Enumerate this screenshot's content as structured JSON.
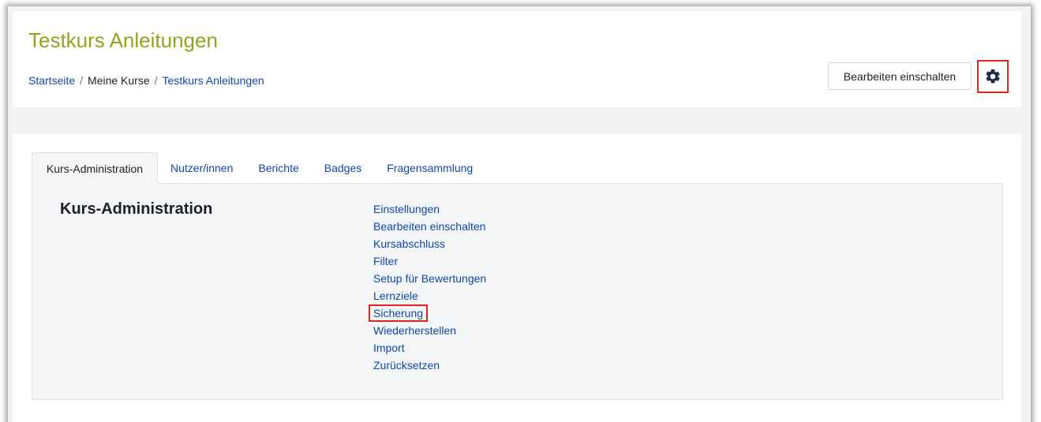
{
  "header": {
    "title": "Testkurs Anleitungen",
    "breadcrumb": [
      {
        "label": "Startseite"
      },
      {
        "label": "Meine Kurse"
      },
      {
        "label": "Testkurs Anleitungen"
      }
    ],
    "breadcrumb_separator": "/",
    "edit_button_label": "Bearbeiten einschalten",
    "settings_icon": "gear-icon"
  },
  "tabs": [
    {
      "label": "Kurs-Administration",
      "active": true
    },
    {
      "label": "Nutzer/innen"
    },
    {
      "label": "Berichte"
    },
    {
      "label": "Badges"
    },
    {
      "label": "Fragensammlung"
    }
  ],
  "panel": {
    "title": "Kurs-Administration",
    "links": [
      {
        "label": "Einstellungen"
      },
      {
        "label": "Bearbeiten einschalten"
      },
      {
        "label": "Kursabschluss"
      },
      {
        "label": "Filter"
      },
      {
        "label": "Setup für Bewertungen"
      },
      {
        "label": "Lernziele"
      },
      {
        "label": "Sicherung",
        "highlighted": true
      },
      {
        "label": "Wiederherstellen"
      },
      {
        "label": "Import"
      },
      {
        "label": "Zurücksetzen"
      }
    ]
  },
  "colors": {
    "title": "#8aa71d",
    "link": "#0f47ad",
    "highlight_border": "#e0251b",
    "gear": "#1b2a4e"
  }
}
